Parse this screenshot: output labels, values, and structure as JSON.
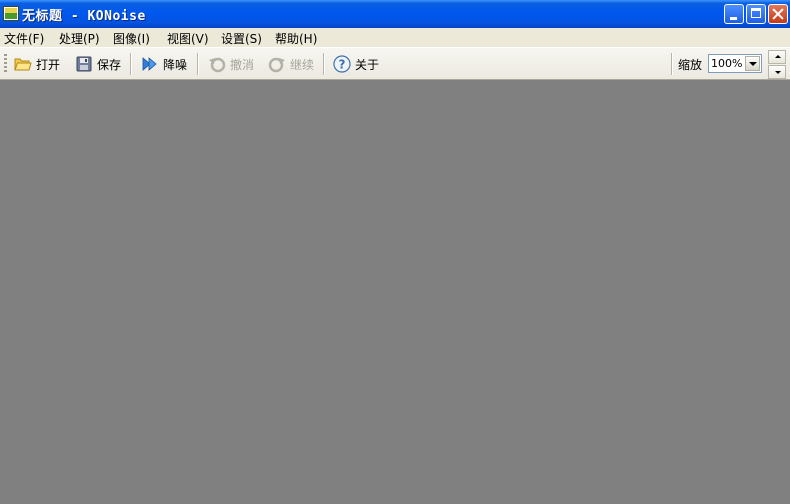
{
  "window": {
    "title": "无标题 - KONoise"
  },
  "menu": [
    {
      "label": "文件(F)"
    },
    {
      "label": "处理(P)"
    },
    {
      "label": "图像(I)"
    },
    {
      "label": "视图(V)"
    },
    {
      "label": "设置(S)"
    },
    {
      "label": "帮助(H)"
    }
  ],
  "toolbar": {
    "open_label": "打开",
    "save_label": "保存",
    "denoise_label": "降噪",
    "undo_label": "撤消",
    "redo_label": "继续",
    "about_label": "关于",
    "zoom_label": "缩放",
    "zoom_value": "100%",
    "icons": {
      "open": "folder-open-icon",
      "save": "floppy-disk-icon",
      "denoise": "double-arrow-icon",
      "undo": "undo-icon",
      "redo": "redo-icon",
      "about": "help-icon"
    }
  },
  "colors": {
    "titlebar": "#0058ee",
    "canvas": "#808080",
    "chrome": "#ece9d8"
  }
}
